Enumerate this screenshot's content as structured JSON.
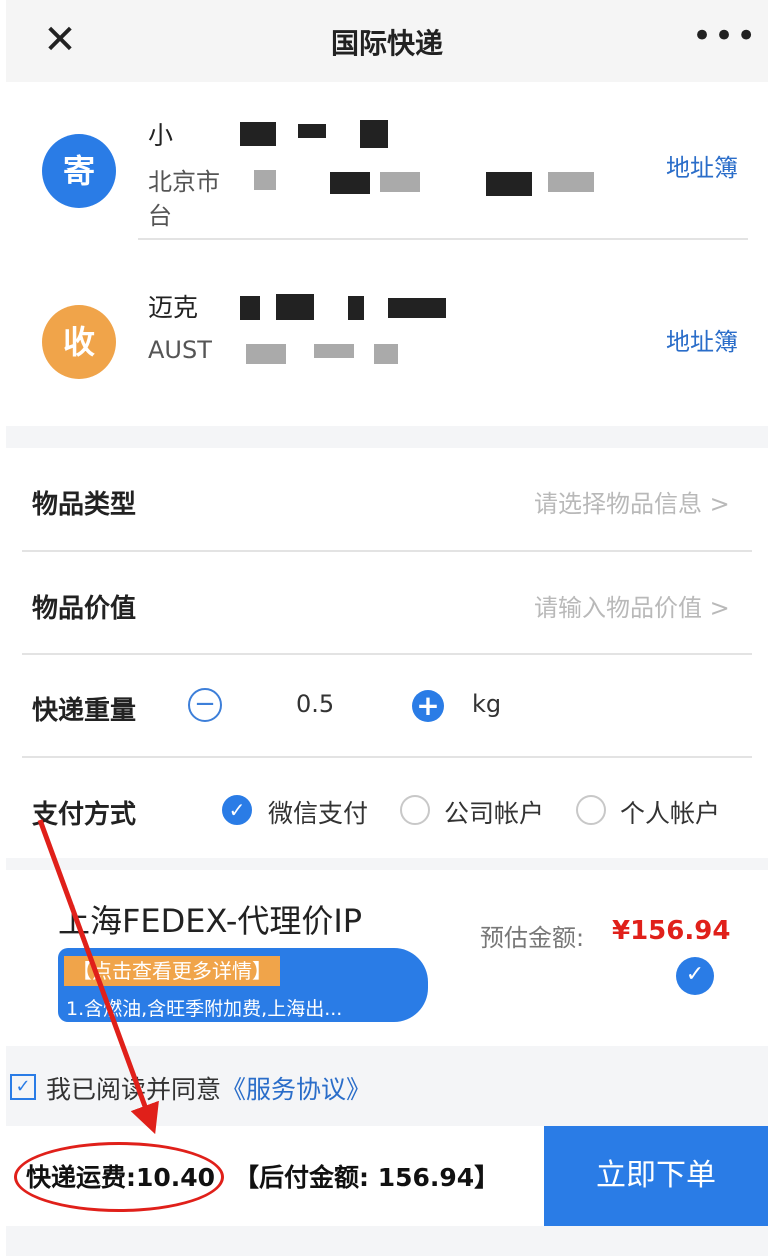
{
  "header": {
    "title": "国际快递",
    "close_icon": "close-icon",
    "more_label": "•••"
  },
  "sender": {
    "badge": "寄",
    "name": "小",
    "address_line1": "北京市",
    "address_line2": "台",
    "address_book": "地址簿"
  },
  "receiver": {
    "badge": "收",
    "name": "迈克",
    "address": "AUST",
    "address_book": "地址簿"
  },
  "form": {
    "item_type": {
      "label": "物品类型",
      "placeholder": "请选择物品信息 >"
    },
    "item_value": {
      "label": "物品价值",
      "placeholder": "请输入物品价值 >"
    },
    "weight": {
      "label": "快递重量",
      "minus": "−",
      "plus": "+",
      "value": "0.5",
      "unit": "kg"
    },
    "payment": {
      "label": "支付方式",
      "options": [
        {
          "label": "微信支付",
          "selected": true
        },
        {
          "label": "公司帐户",
          "selected": false
        },
        {
          "label": "个人帐户",
          "selected": false
        }
      ]
    }
  },
  "carrier": {
    "name": "上海FEDEX-代理价IP",
    "promo_tag": "【点击查看更多详情】",
    "promo_text": "1.含燃油,含旺季附加费,上海出...",
    "estimate_label": "预估金额:",
    "estimate_value": "¥156.94",
    "check": "✓"
  },
  "agreement": {
    "check": "✓",
    "text": "我已阅读并同意",
    "link": "《服务协议》"
  },
  "footer": {
    "fee": "快递运费:10.40",
    "post_pay": "【后付金额: 156.94】",
    "order_button": "立即下单"
  },
  "colors": {
    "accent": "#2a7ce6",
    "orange": "#f0a44a",
    "price_red": "#e0201a",
    "annotation": "#e0201a"
  }
}
